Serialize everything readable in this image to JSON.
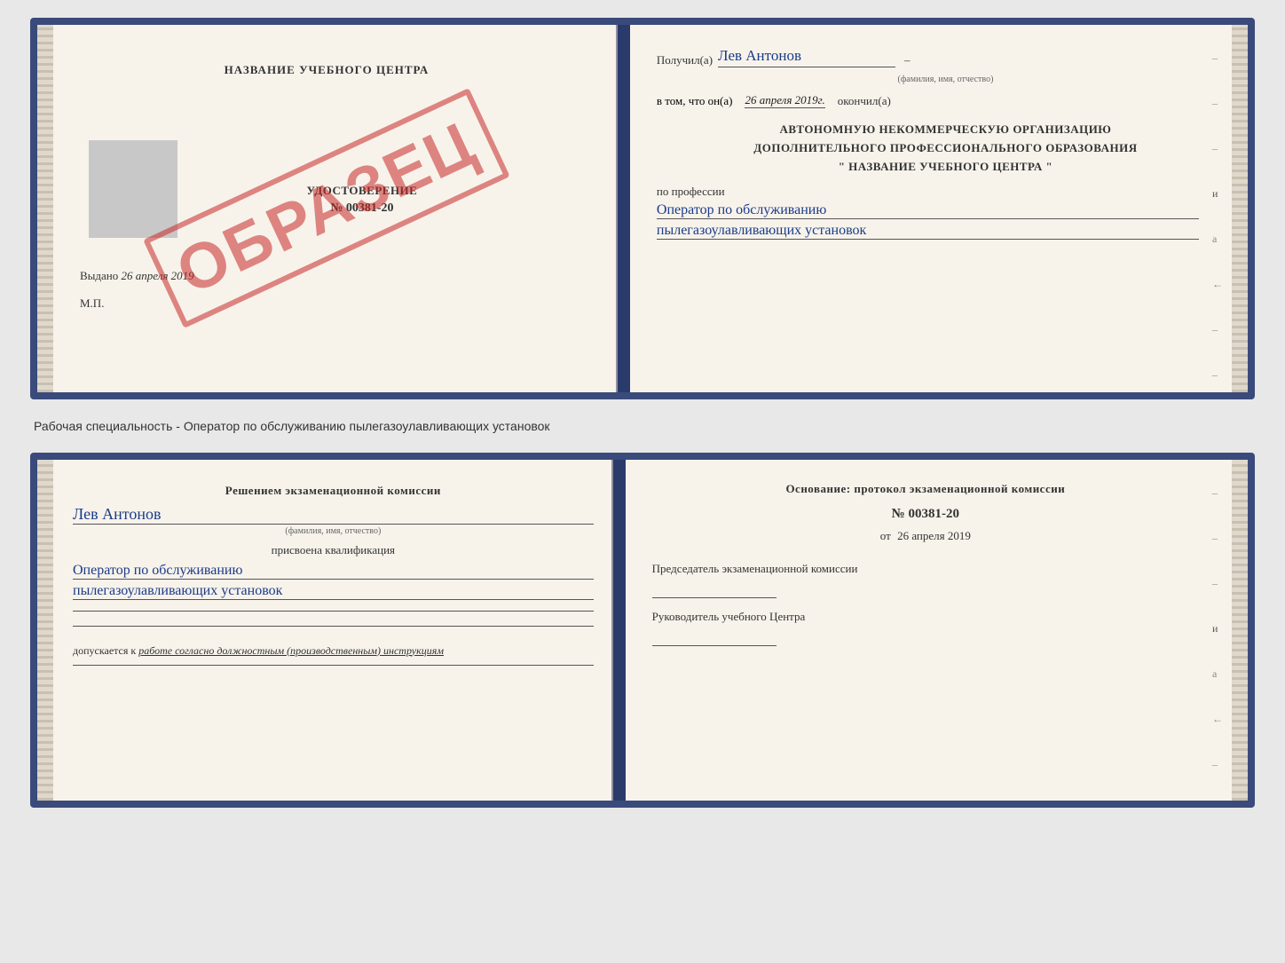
{
  "top_doc": {
    "left": {
      "center_title": "НАЗВАНИЕ УЧЕБНОГО ЦЕНТРА",
      "udostoverenie_label": "УДОСТОВЕРЕНИЕ",
      "number": "№ 00381-20",
      "vydano_label": "Выдано",
      "vydano_date": "26 апреля 2019",
      "mp_label": "М.П.",
      "obrazec": "ОБРАЗЕЦ"
    },
    "right": {
      "poluchil_label": "Получил(а)",
      "fio_value": "Лев Антонов",
      "fio_subtitle": "(фамилия, имя, отчество)",
      "vtom_label": "в том, что он(а)",
      "date_value": "26 апреля 2019г.",
      "okonchil_label": "окончил(а)",
      "org_line1": "АВТОНОМНУЮ НЕКОММЕРЧЕСКУЮ ОРГАНИЗАЦИЮ",
      "org_line2": "ДОПОЛНИТЕЛЬНОГО ПРОФЕССИОНАЛЬНОГО ОБРАЗОВАНИЯ",
      "org_name": "\"   НАЗВАНИЕ УЧЕБНОГО ЦЕНТРА   \"",
      "po_professii_label": "по профессии",
      "profession_line1": "Оператор по обслуживанию",
      "profession_line2": "пылегазоулавливающих установок"
    }
  },
  "separator_text": "Рабочая специальность - Оператор по обслуживанию пылегазоулавливающих установок",
  "bottom_doc": {
    "left": {
      "komissia_line1": "Решением экзаменационной комиссии",
      "fio_value": "Лев Антонов",
      "fio_subtitle": "(фамилия, имя, отчество)",
      "prisvoena_label": "присвоена квалификация",
      "kvali_line1": "Оператор по обслуживанию",
      "kvali_line2": "пылегазоулавливающих установок",
      "dopusk_label": "допускается к",
      "dopusk_value": "работе согласно должностным (производственным) инструкциям"
    },
    "right": {
      "osnovanie_label": "Основание: протокол экзаменационной комиссии",
      "number": "№  00381-20",
      "ot_label": "от",
      "ot_date": "26 апреля 2019",
      "predsedatel_label": "Председатель экзаменационной комиссии",
      "rukovoditel_label": "Руководитель учебного Центра"
    }
  }
}
